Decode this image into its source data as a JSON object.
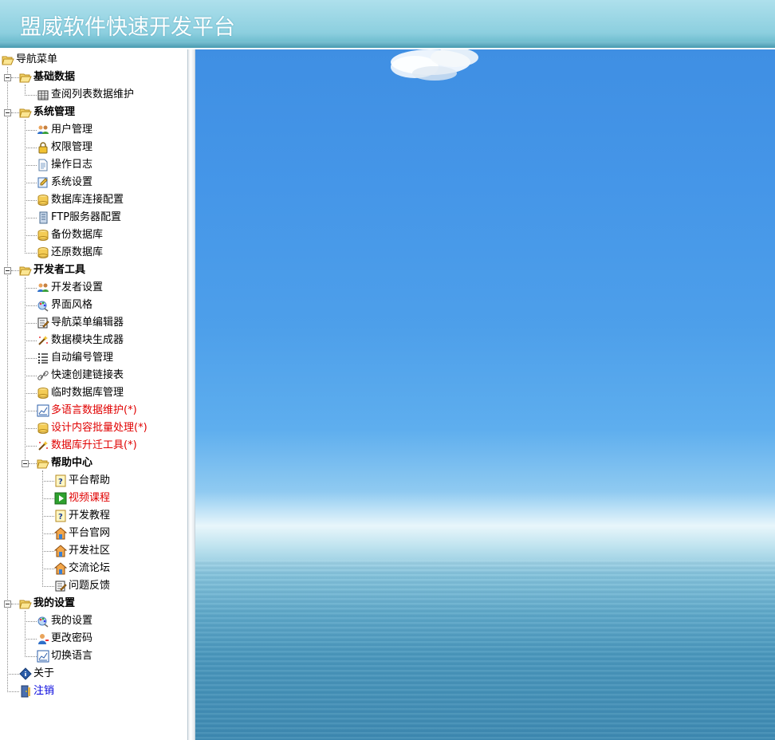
{
  "header": {
    "title": "盟威软件快速开发平台"
  },
  "nav": {
    "root": "导航菜单",
    "groups": {
      "basic": {
        "label": "基础数据",
        "items": [
          "查阅列表数据维护"
        ]
      },
      "system": {
        "label": "系统管理",
        "items": [
          "用户管理",
          "权限管理",
          "操作日志",
          "系统设置",
          "数据库连接配置",
          "FTP服务器配置",
          "备份数据库",
          "还原数据库"
        ]
      },
      "dev": {
        "label": "开发者工具",
        "items": [
          "开发者设置",
          "界面风格",
          "导航菜单编辑器",
          "数据模块生成器",
          "自动编号管理",
          "快速创建链接表",
          "临时数据库管理",
          "多语言数据维护(*)",
          "设计内容批量处理(*)",
          "数据库升迁工具(*)"
        ]
      },
      "help": {
        "label": "帮助中心",
        "items": [
          "平台帮助",
          "视频课程",
          "开发教程",
          "平台官网",
          "开发社区",
          "交流论坛",
          "问题反馈"
        ]
      },
      "mine": {
        "label": "我的设置",
        "items": [
          "我的设置",
          "更改密码",
          "切换语言"
        ]
      }
    },
    "about": "关于",
    "logout": "注销"
  },
  "icons": {
    "folder": "folder-open-icon",
    "grid": "grid-icon",
    "users": "users-icon",
    "lock": "lock-icon",
    "doc": "document-icon",
    "settings": "settings-icon",
    "db": "database-icon",
    "server": "server-icon",
    "paint": "palette-icon",
    "edit": "edit-icon",
    "wand": "wand-icon",
    "list": "list-icon",
    "link": "link-icon",
    "chart": "chart-icon",
    "help": "help-icon",
    "video": "video-icon",
    "home": "home-icon",
    "user": "user-key-icon",
    "info": "info-icon",
    "door": "door-icon"
  }
}
